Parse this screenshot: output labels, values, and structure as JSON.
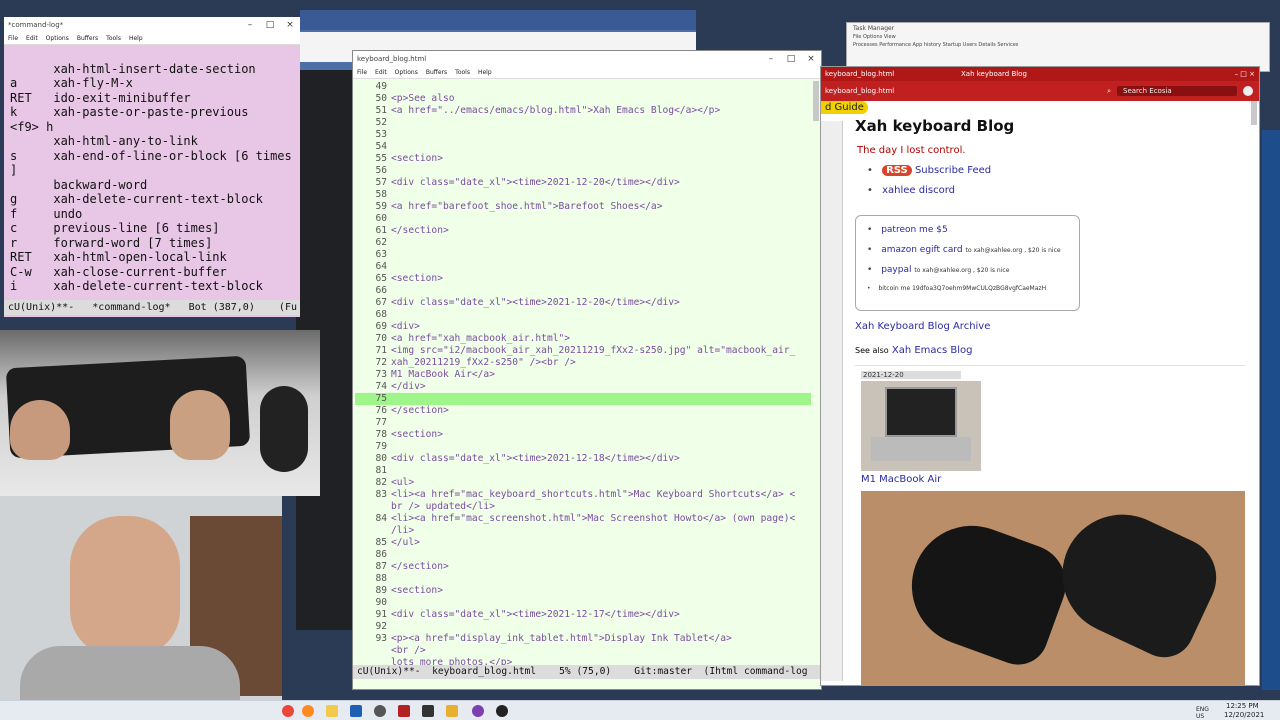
{
  "desktop": {
    "background": "#2b3a55"
  },
  "command_log": {
    "title": "*command-log*",
    "menu": [
      "File",
      "Edit",
      "Options",
      "Buffers",
      "Tools",
      "Help"
    ],
    "lines": [
      "      xah-html-insert-date-section",
      "a     xah-fly-M-x",
      "RET   ido-exit-minibuffer",
      "k     xah-paste-or-paste-previous",
      "<f9> h",
      "      xah-html-any-to-link",
      "s     xah-end-of-line-or-block [6 times",
      "]",
      "      backward-word",
      "g     xah-delete-current-text-block",
      "f     undo",
      "c     previous-line [6 times]",
      "r     forward-word [7 times]",
      "RET   xah-html-open-local-link",
      "C-w   xah-close-current-buffer",
      "i     xah-delete-current-text-block"
    ],
    "modeline": "cU(Unix)**-   *command-log*   Bot (387,0)    (Fu"
  },
  "editor": {
    "title": "keyboard_blog.html",
    "menu": [
      "File",
      "Edit",
      "Options",
      "Buffers",
      "Tools",
      "Help"
    ],
    "highlight_color": "#9ef58a",
    "lines": [
      [
        "49",
        ""
      ],
      [
        "50",
        "<p>See also"
      ],
      [
        "51",
        "<a href=\"../emacs/emacs/blog.html\">Xah Emacs Blog</a></p>"
      ],
      [
        "52",
        ""
      ],
      [
        "53",
        ""
      ],
      [
        "54",
        ""
      ],
      [
        "55",
        "<section>"
      ],
      [
        "56",
        ""
      ],
      [
        "57",
        "<div class=\"date_xl\"><time>2021-12-20</time></div>"
      ],
      [
        "58",
        ""
      ],
      [
        "59",
        "<a href=\"barefoot_shoe.html\">Barefoot Shoes</a>"
      ],
      [
        "60",
        ""
      ],
      [
        "61",
        "</section>"
      ],
      [
        "62",
        ""
      ],
      [
        "63",
        ""
      ],
      [
        "64",
        ""
      ],
      [
        "65",
        "<section>"
      ],
      [
        "66",
        ""
      ],
      [
        "67",
        "<div class=\"date_xl\"><time>2021-12-20</time></div>"
      ],
      [
        "68",
        ""
      ],
      [
        "69",
        "<div>"
      ],
      [
        "70",
        "<a href=\"xah_macbook_air.html\">"
      ],
      [
        "71",
        "<img src=\"i2/macbook_air_xah_20211219_fXx2-s250.jpg\" alt=\"macbook_air_"
      ],
      [
        "72",
        "xah_20211219_fXx2-s250\" /><br />"
      ],
      [
        "73",
        "M1 MacBook Air</a>"
      ],
      [
        "74",
        "</div>"
      ],
      [
        "75",
        ""
      ],
      [
        "76",
        "</section>"
      ],
      [
        "77",
        ""
      ],
      [
        "78",
        "<section>"
      ],
      [
        "79",
        ""
      ],
      [
        "80",
        "<div class=\"date_xl\"><time>2021-12-18</time></div>"
      ],
      [
        "81",
        ""
      ],
      [
        "82",
        "<ul>"
      ],
      [
        "83",
        "<li><a href=\"mac_keyboard_shortcuts.html\">Mac Keyboard Shortcuts</a> <"
      ],
      [
        "",
        "br /> updated</li>"
      ],
      [
        "84",
        "<li><a href=\"mac_screenshot.html\">Mac Screenshot Howto</a> (own page)<"
      ],
      [
        "",
        "/li>"
      ],
      [
        "85",
        "</ul>"
      ],
      [
        "86",
        ""
      ],
      [
        "87",
        "</section>"
      ],
      [
        "88",
        ""
      ],
      [
        "89",
        "<section>"
      ],
      [
        "90",
        ""
      ],
      [
        "91",
        "<div class=\"date_xl\"><time>2021-12-17</time></div>"
      ],
      [
        "92",
        ""
      ],
      [
        "93",
        "<p><a href=\"display_ink_tablet.html\">Display Ink Tablet</a>"
      ],
      [
        "",
        "<br />"
      ],
      [
        "",
        "lots more photos.</p>"
      ]
    ],
    "modeline": "cU(Unix)**-  keyboard_blog.html    5% (75,0)    Git:master  (Ihtml command-log"
  },
  "browser": {
    "title": "Xah keyboard Blog",
    "tab_label": "keyboard_blog.html",
    "search_placeholder": "Search Ecosia",
    "guide_label": "d Guide",
    "page": {
      "heading": "Xah keyboard Blog",
      "tagline": "The day I lost control.",
      "rss_badge": "RSS",
      "subscribe": "Subscribe Feed",
      "discord": "xahlee discord",
      "patreon": "patreon me $5",
      "amazon": "amazon egift card",
      "amazon_note": "to xah@xahlee.org , $20 is nice",
      "paypal": "paypal",
      "paypal_note": "to xah@xahlee.org , $20 is nice",
      "bitcoin": "bitcoin me 19dfoa3Q7oehm9MwCULQzBG8vgfCaeMazH",
      "archive": "Xah Keyboard Blog Archive",
      "see_also_label": "See also",
      "see_also_link": "Xah Emacs Blog",
      "date": "2021-12-20",
      "caption": "M1 MacBook Air"
    }
  },
  "taskbar": {
    "clock_time": "12:25 PM",
    "clock_date": "12/20/2021",
    "lang": "ENG US"
  }
}
